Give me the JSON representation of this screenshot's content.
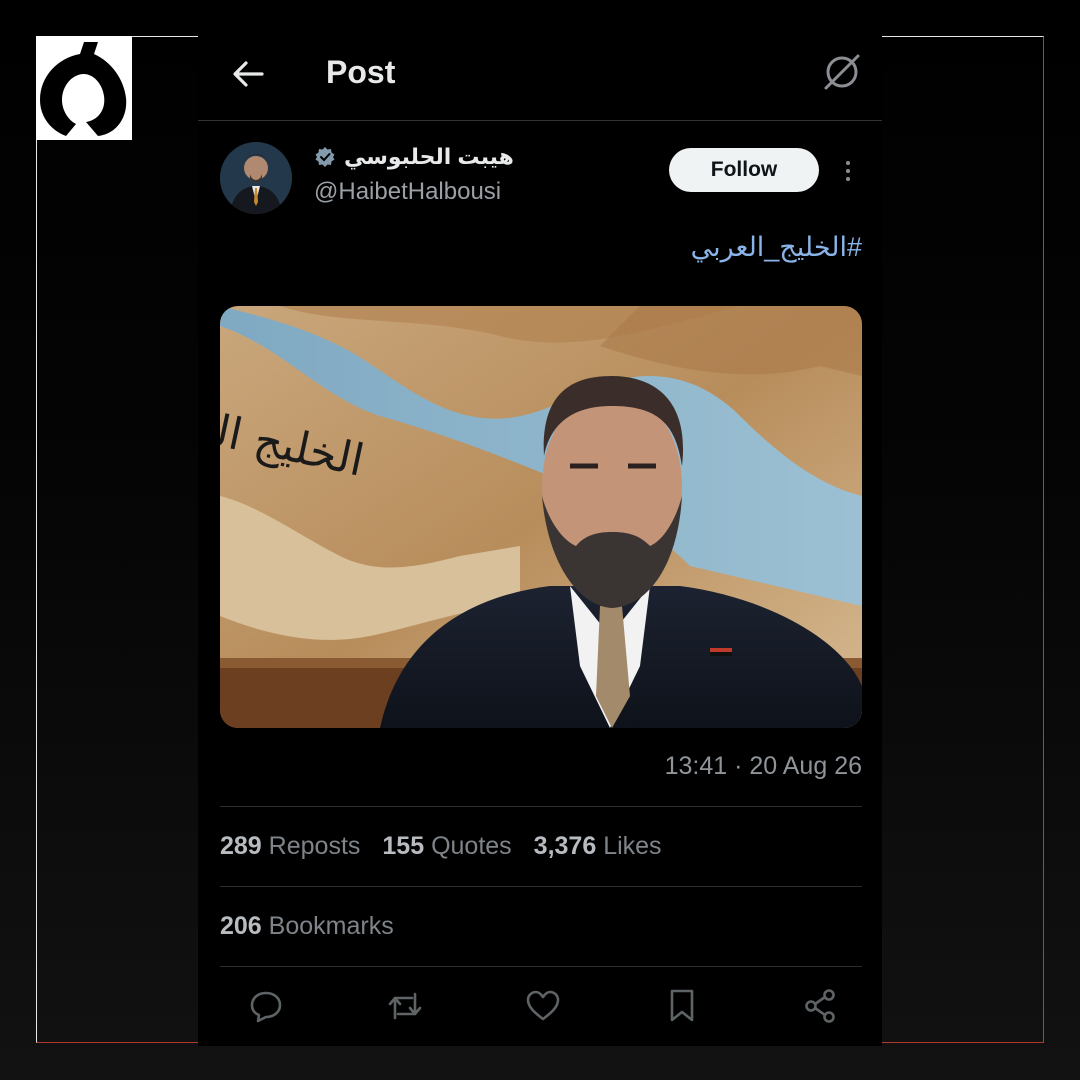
{
  "header": {
    "title": "Post"
  },
  "author": {
    "display_name": "هيبت الحلبوسي",
    "handle": "@HaibetHalbousi",
    "verified": true
  },
  "follow_label": "Follow",
  "post": {
    "text": "#الخليج_العربي",
    "image_caption": "الخليج العربي",
    "timestamp": "13:41 · 20 Aug 26"
  },
  "stats": {
    "reposts": {
      "count": "289",
      "label": "Reposts"
    },
    "quotes": {
      "count": "155",
      "label": "Quotes"
    },
    "likes": {
      "count": "3,376",
      "label": "Likes"
    },
    "bookmarks": {
      "count": "206",
      "label": "Bookmarks"
    }
  },
  "icons": {
    "back": "arrow-left-icon",
    "grok": "grok-icon",
    "verified": "verified-badge-icon",
    "more": "more-vertical-icon",
    "reply": "reply-icon",
    "repost": "repost-icon",
    "like": "heart-icon",
    "bookmark": "bookmark-icon",
    "share": "share-icon"
  },
  "colors": {
    "background": "#000000",
    "link": "#8ab4e8",
    "follow_bg": "#eff3f4",
    "frame_accent": "#c0392b"
  }
}
